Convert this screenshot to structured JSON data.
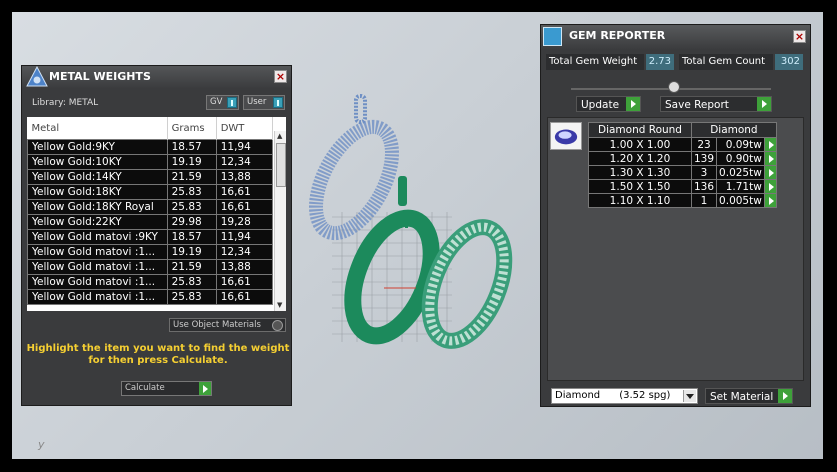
{
  "metal_weights": {
    "title": "METAL WEIGHTS",
    "library_label": "Library: METAL",
    "toggle_gv": "GV",
    "toggle_user": "User",
    "columns": [
      "Metal",
      "Grams",
      "DWT"
    ],
    "rows": [
      [
        "Yellow Gold:9KY",
        "18.57",
        "11,94"
      ],
      [
        "Yellow Gold:10KY",
        "19.19",
        "12,34"
      ],
      [
        "Yellow Gold:14KY",
        "21.59",
        "13,88"
      ],
      [
        "Yellow Gold:18KY",
        "25.83",
        "16,61"
      ],
      [
        "Yellow Gold:18KY Royal",
        "25.83",
        "16,61"
      ],
      [
        "Yellow Gold:22KY",
        "29.98",
        "19,28"
      ],
      [
        "Yellow Gold matovi :9KY",
        "18.57",
        "11,94"
      ],
      [
        "Yellow Gold matovi :1...",
        "19.19",
        "12,34"
      ],
      [
        "Yellow Gold matovi :1...",
        "21.59",
        "13,88"
      ],
      [
        "Yellow Gold matovi :1...",
        "25.83",
        "16,61"
      ],
      [
        "Yellow Gold matovi :1...",
        "25.83",
        "16,61"
      ]
    ],
    "use_object_materials": "Use Object Materials",
    "hint": "Highlight the item you want to find the weight for then press Calculate.",
    "calculate": "Calculate"
  },
  "gem_reporter": {
    "title": "GEM REPORTER",
    "total_weight_label": "Total Gem Weight",
    "total_weight_value": "2.73",
    "total_count_label": "Total Gem Count",
    "total_count_value": "302",
    "update_label": "Update",
    "save_report_label": "Save Report",
    "table_headers": [
      "Diamond Round",
      "Diamond"
    ],
    "rows": [
      [
        "1.00 X 1.00",
        "23",
        "0.09tw"
      ],
      [
        "1.20 X 1.20",
        "139",
        "0.90tw"
      ],
      [
        "1.30 X 1.30",
        "3",
        "0.025tw"
      ],
      [
        "1.50 X 1.50",
        "136",
        "1.71tw"
      ],
      [
        "1.10 X 1.10",
        "1",
        "0.005tw"
      ]
    ],
    "material_select": "Diamond      (3.52 spg)",
    "set_material_label": "Set Material"
  },
  "corner_glyph": "y",
  "colors": {
    "background": "#c9cfd5",
    "panel": "#3a3b3d",
    "accent_green": "#3ea13a",
    "hint_yellow": "#f5cf32",
    "wire_blue": "#6e8fc4",
    "ring_green": "#1c8a5c"
  }
}
